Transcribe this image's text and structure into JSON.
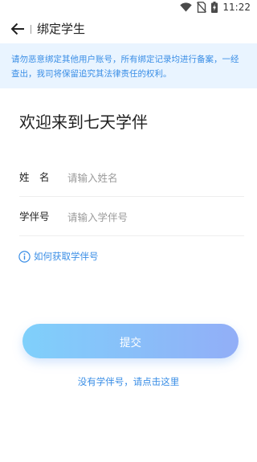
{
  "status_bar": {
    "time": "11:22",
    "icons": [
      "wifi-icon",
      "no-sim-icon",
      "battery-charging-icon"
    ]
  },
  "nav": {
    "back_icon": "arrow-left-icon",
    "title": "绑定学生"
  },
  "notice": {
    "text": "请勿恶意绑定其他用户账号，所有绑定记录均进行备案，一经查出，我司将保留追究其法律责任的权利。"
  },
  "welcome": {
    "title": "欢迎来到七天学伴"
  },
  "form": {
    "name": {
      "label": "姓　名",
      "value": "",
      "placeholder": "请输入姓名"
    },
    "student_id": {
      "label": "学伴号",
      "value": "",
      "placeholder": "请输入学伴号"
    }
  },
  "help": {
    "icon": "info-icon",
    "text": "如何获取学伴号"
  },
  "submit": {
    "label": "提交"
  },
  "register": {
    "text": "没有学伴号，请点击这里"
  },
  "colors": {
    "accent": "#3a8ee6",
    "notice_bg": "#e9f4ff",
    "button_gradient_start": "#7fd0fb",
    "button_gradient_end": "#92aef7"
  }
}
